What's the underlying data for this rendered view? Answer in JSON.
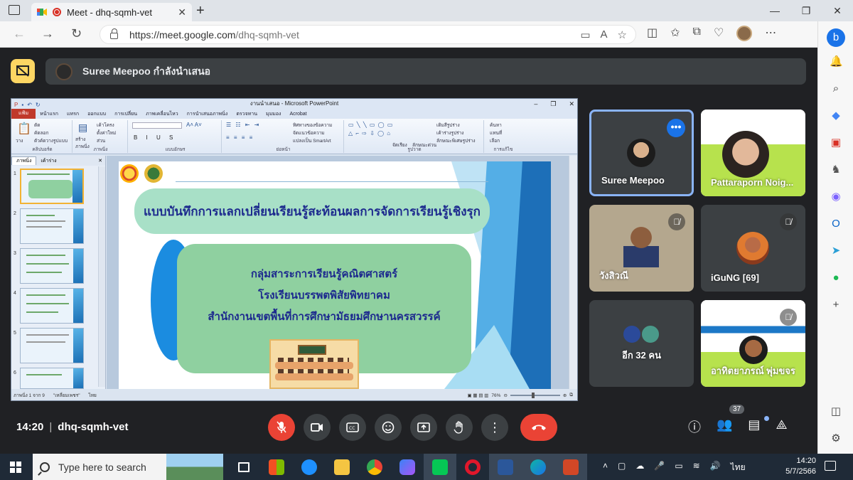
{
  "browser": {
    "tab_title": "Meet - dhq-sqmh-vet",
    "tab_close": "✕",
    "new_tab": "+",
    "url_host": "https://meet.google.com",
    "url_path": "/dhq-sqmh-vet",
    "window_controls": [
      "—",
      "❐",
      "✕"
    ]
  },
  "meet": {
    "presenting_banner": "Suree Meepoo กำลังนำเสนอ",
    "meeting_time": "14:20",
    "meeting_code": "dhq-sqmh-vet",
    "participant_count": "37",
    "participants": [
      {
        "name": "Suree Meepoo",
        "active_speaker": true
      },
      {
        "name": "Pattaraporn Noig...",
        "muted": false
      },
      {
        "name": "วังสิวณี",
        "muted": true
      },
      {
        "name": "iGuNG [69]",
        "muted": true
      },
      {
        "name": "อีก 32 คน",
        "muted": false
      },
      {
        "name": "อาทิตยาภรณ์ พุ่มขจร",
        "muted": true
      }
    ]
  },
  "ppt": {
    "window_title": "งานนำเสนอ - Microsoft PowerPoint",
    "ribbon_tabs": [
      "แฟ้ม",
      "หน้าแรก",
      "แทรก",
      "ออกแบบ",
      "การเปลี่ยน",
      "ภาพเคลื่อนไหว",
      "การนำเสนอภาพนิ่ง",
      "ตรวจทาน",
      "มุมมอง",
      "Acrobat"
    ],
    "ribbon_groups": [
      "คลิปบอร์ด",
      "ภาพนิ่ง",
      "แบบอักษร",
      "ย่อหน้า",
      "รูปวาด",
      "การแก้ไข"
    ],
    "ribbon_labels": {
      "paste": "วาง",
      "cut": "ตัด",
      "copy": "คัดลอก",
      "format_painter": "ตัวคัดวางรูปแบบ",
      "new_slide": "สร้างภาพนิ่ง",
      "layout": "เค้าโครง",
      "reset": "ตั้งค่าใหม่",
      "section": "ส่วน",
      "text_direction": "ทิศทางของข้อความ",
      "align_text": "จัดแนวข้อความ",
      "smartart": "แปลงเป็น SmartArt",
      "arrange": "จัดเรียง",
      "quick_styles": "ลักษณะด่วน",
      "shape_fill": "เติมสีรูปร่าง",
      "shape_outline": "เค้าร่างรูปร่าง",
      "shape_effects": "ลักษณะพิเศษรูปร่าง",
      "find": "ค้นหา",
      "replace": "แทนที่",
      "select": "เลือก"
    },
    "panel_tabs": [
      "ภาพนิ่ง",
      "เค้าร่าง"
    ],
    "slide_numbers": [
      "1",
      "2",
      "3",
      "4",
      "5",
      "6"
    ],
    "slide": {
      "title": "แบบบันทึกการแลกเปลี่ยนเรียนรู้สะท้อนผลการจัดการเรียนรู้เชิงรุก",
      "line1": "กลุ่มสาระการเรียนรู้คณิตศาสตร์",
      "line2": "โรงเรียนบรรพตพิสัยพิทยาคม",
      "line3": "สำนักงานเขตพื้นที่การศึกษามัธยมศึกษานครสวรรค์"
    },
    "status": {
      "slide_of": "ภาพนิ่ง 1 จาก 9",
      "theme": "\"เหลี่ยมเพชร\"",
      "lang": "ไทย",
      "zoom": "76%"
    }
  },
  "taskbar": {
    "search_placeholder": "Type here to search",
    "time": "14:20",
    "date": "5/7/2566",
    "lang": "ไทย"
  },
  "colors": {
    "meet_bg": "#202124",
    "tile_bg": "#3c4043",
    "end_call": "#ea4335",
    "active_border": "#8ab4f8",
    "slide_title_text": "#1d2a8e"
  }
}
